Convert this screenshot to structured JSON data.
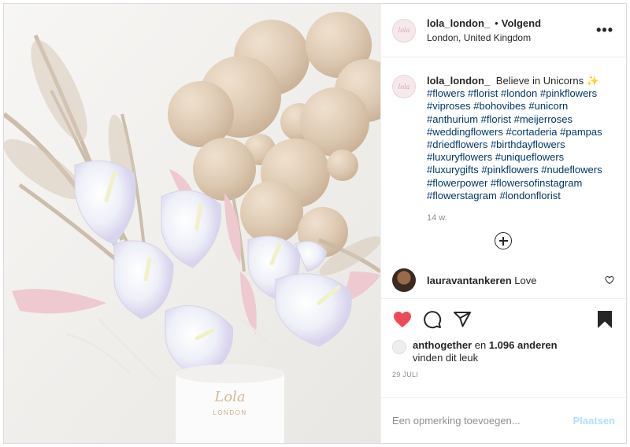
{
  "post": {
    "author": {
      "username": "lola_london_",
      "follow_label": "Volgend",
      "separator": "•",
      "location": "London, United Kingdom",
      "avatar_text": "lola"
    },
    "more_icon": "more-horizontal-icon",
    "caption": {
      "username": "lola_london_",
      "text": "Believe in Unicorns ✨",
      "hashtags": [
        "#flowers",
        "#florist",
        "#london",
        "#pinkflowers",
        "#viproses",
        "#bohovibes",
        "#unicorn",
        "#anthurium",
        "#florist",
        "#meijerroses",
        "#weddingflowers",
        "#cortaderia",
        "#pampas",
        "#driedflowers",
        "#birthdayflowers",
        "#luxuryflowers",
        "#uniqueflowers",
        "#luxurygifts",
        "#pinkflowers",
        "#nudeflowers",
        "#flowerpower",
        "#flowersofinstagram",
        "#flowerstagram",
        "#londonflorist"
      ],
      "time_ago": "14 w."
    },
    "comments": [
      {
        "username": "lauravantankeren",
        "text": "Love"
      }
    ],
    "likes": {
      "username": "anthogether",
      "conjunction": "en",
      "others": "1.096 anderen",
      "suffix": "vinden dit leuk"
    },
    "date": "29 JULI",
    "add_comment": {
      "placeholder": "Een opmerking toevoegen...",
      "post_label": "Plaatsen"
    },
    "image": {
      "box_text": "Lola",
      "box_subtext": "LONDON"
    }
  },
  "colors": {
    "like_red": "#ed4956",
    "hashtag_blue": "#00376b",
    "post_button_disabled": "#b2dffc",
    "muted": "#8e8e8e"
  },
  "icons": [
    "heart-icon",
    "comment-icon",
    "share-icon",
    "bookmark-icon",
    "add-circle-icon",
    "heart-outline-icon"
  ]
}
